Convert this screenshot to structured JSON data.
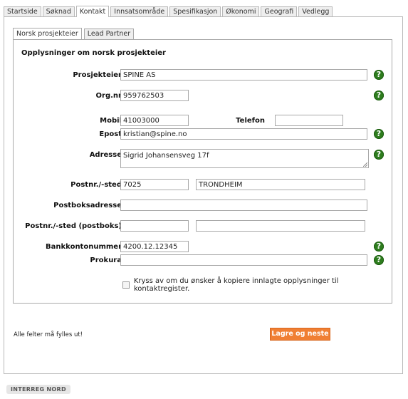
{
  "top_tabs": [
    "Startside",
    "Søknad",
    "Kontakt",
    "Innsatsområde",
    "Spesifikasjon",
    "Økonomi",
    "Geografi",
    "Vedlegg"
  ],
  "active_top_tab": "Kontakt",
  "sub_tabs": [
    "Norsk prosjekteier",
    "Lead Partner"
  ],
  "active_sub_tab": "Norsk prosjekteier",
  "form": {
    "section_title": "Opplysninger om norsk prosjekteier",
    "labels": {
      "prosjekteier": "Prosjekteier",
      "orgnr": "Org.nr",
      "mobil": "Mobil",
      "telefon": "Telefon",
      "epost": "Epost",
      "adresse": "Adresse",
      "postnr_sted": "Postnr./-sted",
      "postboksadresse": "Postboksadresse",
      "postnr_sted_postboks": "Postnr./-sted (postboks)",
      "bankkontonummer": "Bankkontonummer",
      "prokura": "Prokura"
    },
    "values": {
      "prosjekteier": "SPINE AS",
      "orgnr": "959762503",
      "mobil": "41003000",
      "telefon": "",
      "epost": "kristian@spine.no",
      "adresse": "Sigrid Johansensveg 17f",
      "postnr": "7025",
      "sted": "TRONDHEIM",
      "postboksadresse": "",
      "postboks_postnr": "",
      "postboks_sted": "",
      "bankkontonummer": "4200.12.12345",
      "prokura": ""
    },
    "help_symbol": "?",
    "copy_checkbox_label": "Kryss av om du ønsker å kopiere innlagte opplysninger til kontaktregister.",
    "copy_checkbox_checked": false
  },
  "required_note": "Alle felter må fylles ut!",
  "save_button_label": "Lagre og neste",
  "footer_badge": "INTERREG NORD",
  "colors": {
    "help_icon": "#2e7d1e",
    "save_button": "#f07f33",
    "active_tab_bg": "#ffffff",
    "inactive_tab_bg": "#eeeeee"
  }
}
